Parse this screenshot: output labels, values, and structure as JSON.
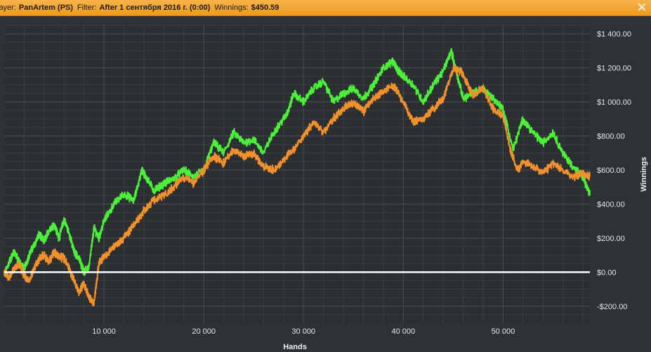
{
  "header": {
    "player_label": "layer:",
    "player_value": "PanArtem (PS)",
    "filter_label": "Filter:",
    "filter_value": "After 1 сентября 2016 г. (0:00)",
    "winnings_label": "Winnings:",
    "winnings_value": "$450.59",
    "close_icon": "close-icon"
  },
  "colors": {
    "background": "#2f3235",
    "plot_background": "#2c2f32",
    "grid_major": "#4a4e52",
    "grid_minor": "#3a3d41",
    "winnings_line": "#4cf03a",
    "second_line": "#f2912c",
    "zero_line": "#ffffff",
    "header": "#f5a630"
  },
  "chart_data": {
    "type": "line",
    "xlabel": "Hands",
    "ylabel": "Winnings",
    "xlim": [
      0,
      58700
    ],
    "ylim": [
      -300,
      1450
    ],
    "x_ticks": [
      {
        "value": 10000,
        "label": "10 000"
      },
      {
        "value": 20000,
        "label": "20 000"
      },
      {
        "value": 30000,
        "label": "30 000"
      },
      {
        "value": 40000,
        "label": "40 000"
      },
      {
        "value": 50000,
        "label": "50 000"
      }
    ],
    "y_ticks": [
      {
        "value": 1400,
        "label": "$1 400.00"
      },
      {
        "value": 1200,
        "label": "$1 200.00"
      },
      {
        "value": 1000,
        "label": "$1 000.00"
      },
      {
        "value": 800,
        "label": "$800.00"
      },
      {
        "value": 600,
        "label": "$600.00"
      },
      {
        "value": 400,
        "label": "$400.00"
      },
      {
        "value": 200,
        "label": "$200.00"
      },
      {
        "value": 0,
        "label": "$0.00"
      },
      {
        "value": -200,
        "label": "-$200.00"
      }
    ],
    "grid": true,
    "zero_line": true,
    "series": [
      {
        "color": "#4cf03a",
        "x": [
          0,
          500,
          1000,
          1500,
          2000,
          2500,
          3000,
          3500,
          4000,
          4500,
          5000,
          5500,
          6000,
          6500,
          7000,
          7500,
          8000,
          8500,
          9000,
          9500,
          10000,
          11000,
          12000,
          13000,
          13800,
          14200,
          15000,
          16000,
          17000,
          18000,
          19000,
          20000,
          21000,
          22000,
          23000,
          24000,
          25000,
          26000,
          27000,
          28000,
          28500,
          29000,
          30000,
          31000,
          32000,
          33000,
          34000,
          35000,
          36000,
          37000,
          38000,
          39000,
          39500,
          40000,
          41000,
          42000,
          43000,
          44000,
          44800,
          45300,
          46000,
          47000,
          48000,
          49000,
          50000,
          51000,
          52000,
          53000,
          54000,
          55000,
          56000,
          57000,
          58000,
          58700
        ],
        "values": [
          -20,
          60,
          120,
          60,
          20,
          100,
          160,
          220,
          180,
          250,
          280,
          200,
          310,
          230,
          120,
          80,
          0,
          30,
          260,
          200,
          300,
          400,
          460,
          420,
          600,
          560,
          480,
          520,
          550,
          600,
          560,
          600,
          760,
          700,
          820,
          760,
          780,
          700,
          820,
          900,
          950,
          1050,
          1000,
          1080,
          1120,
          1000,
          1050,
          1080,
          1020,
          1100,
          1200,
          1240,
          1180,
          1150,
          1100,
          1000,
          1100,
          1180,
          1300,
          1180,
          1020,
          1050,
          1080,
          1020,
          960,
          720,
          900,
          820,
          760,
          820,
          700,
          620,
          560,
          450
        ]
      },
      {
        "color": "#f2912c",
        "x": [
          0,
          500,
          1000,
          1500,
          2000,
          2500,
          3000,
          3500,
          4000,
          4500,
          5000,
          5500,
          6000,
          6500,
          7000,
          7500,
          8000,
          8500,
          9000,
          9500,
          10000,
          11000,
          12000,
          13000,
          14000,
          15000,
          16000,
          17000,
          18000,
          19000,
          20000,
          21000,
          22000,
          23000,
          24000,
          25000,
          26000,
          27000,
          28000,
          29000,
          30000,
          31000,
          32000,
          33000,
          34000,
          35000,
          36000,
          37000,
          38000,
          39000,
          40000,
          41000,
          42000,
          43000,
          44000,
          45000,
          45800,
          46500,
          47000,
          48000,
          49000,
          50000,
          50800,
          51500,
          52000,
          53000,
          54000,
          55000,
          56000,
          57000,
          58000,
          58700
        ],
        "values": [
          0,
          -30,
          20,
          50,
          -20,
          -50,
          20,
          80,
          100,
          60,
          120,
          90,
          80,
          20,
          -50,
          -120,
          -60,
          -150,
          -180,
          60,
          90,
          150,
          200,
          280,
          360,
          420,
          450,
          500,
          560,
          520,
          600,
          680,
          640,
          720,
          680,
          700,
          620,
          600,
          660,
          720,
          800,
          880,
          820,
          900,
          960,
          1000,
          940,
          1020,
          1060,
          1100,
          1000,
          880,
          900,
          960,
          1020,
          1200,
          1180,
          1100,
          1040,
          1080,
          960,
          920,
          700,
          600,
          650,
          620,
          580,
          640,
          600,
          560,
          580,
          560
        ]
      }
    ]
  }
}
